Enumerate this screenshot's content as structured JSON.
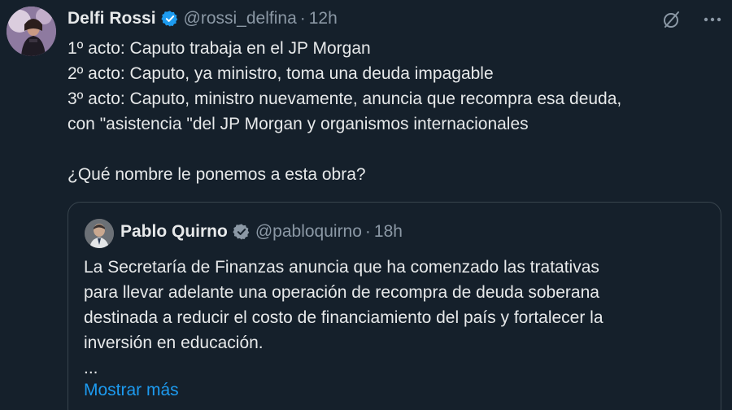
{
  "tweet": {
    "author_name": "Delfi Rossi",
    "handle": "@rossi_delfina",
    "separator": "·",
    "time": "12h",
    "lines": [
      "1º acto: Caputo trabaja en el JP Morgan",
      "2º acto: Caputo, ya ministro, toma una deuda impagable",
      "3º acto: Caputo, ministro nuevamente, anuncia que recompra esa deuda,",
      "con \"asistencia \"del JP Morgan y organismos internacionales"
    ],
    "question": "¿Qué nombre le ponemos a esta obra?",
    "icons": {
      "grok": "slashed-circle-icon",
      "more": "more-dots-icon",
      "verified": "verified-badge-icon"
    }
  },
  "quote": {
    "author_name": "Pablo Quirno",
    "handle": "@pabloquirno",
    "separator": "·",
    "time": "18h",
    "lines": [
      "La Secretaría de Finanzas anuncia que ha comenzado las tratativas",
      "para  llevar adelante una operación de recompra de deuda soberana",
      "destinada a reducir el costo de financiamiento del país y fortalecer la",
      "inversión en educación."
    ],
    "ellipsis": "...",
    "show_more": "Mostrar más"
  },
  "colors": {
    "background": "#15202b",
    "text": "#e7e9ea",
    "secondary": "#8b98a5",
    "accent": "#1d9bf0",
    "border": "#38444d"
  }
}
